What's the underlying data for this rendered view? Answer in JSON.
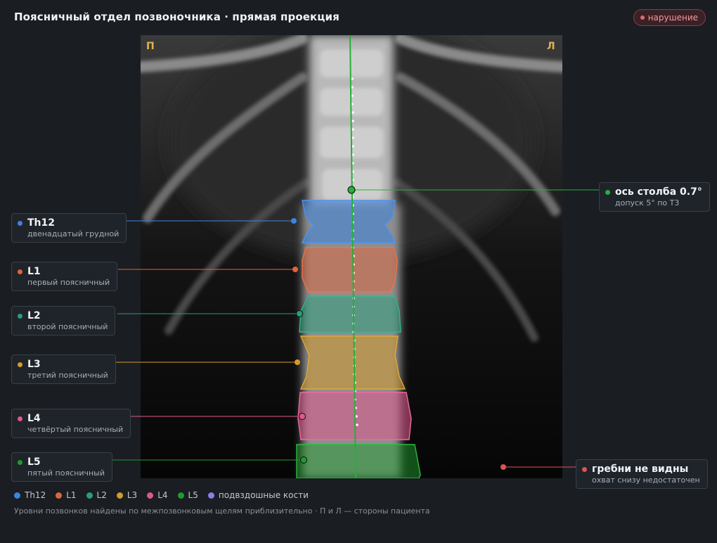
{
  "header": {
    "title": "Поясничный отдел позвоночника · прямая проекция"
  },
  "status_badge": {
    "label": "нарушение",
    "color": "#e06a72"
  },
  "scan": {
    "side_right": "П",
    "side_left": "Л"
  },
  "axis": {
    "label": "ось столба 0.7°",
    "sub": "допуск 5° по Т3",
    "color": "#25b039"
  },
  "vertebrae": [
    {
      "id": "th12",
      "label": "Th12",
      "sub": "двенадцатый грудной",
      "color": "#3d84e0"
    },
    {
      "id": "l1",
      "label": "L1",
      "sub": "первый поясничный",
      "color": "#e2643a"
    },
    {
      "id": "l2",
      "label": "L2",
      "sub": "второй поясничный",
      "color": "#25a07c"
    },
    {
      "id": "l3",
      "label": "L3",
      "sub": "третий поясничный",
      "color": "#d49a2a"
    },
    {
      "id": "l4",
      "label": "L4",
      "sub": "четвёртый поясничный",
      "color": "#e0578e"
    },
    {
      "id": "l5",
      "label": "L5",
      "sub": "пятый поясничный",
      "color": "#1f9b2e"
    }
  ],
  "crests": {
    "label": "гребни не видны",
    "sub": "охват снизу недостаточен",
    "color": "#e05258"
  },
  "legend": [
    {
      "label": "Th12",
      "color": "#3d84e0"
    },
    {
      "label": "L1",
      "color": "#e2643a"
    },
    {
      "label": "L2",
      "color": "#25a07c"
    },
    {
      "label": "L3",
      "color": "#d49a2a"
    },
    {
      "label": "L4",
      "color": "#e0578e"
    },
    {
      "label": "L5",
      "color": "#1f9b2e"
    },
    {
      "label": "подвздошные кости",
      "color": "#8d7de8"
    }
  ],
  "footnote": "Уровни позвонков найдены по межпозвонковым щелям приблизительно · П и Л — стороны пациента"
}
